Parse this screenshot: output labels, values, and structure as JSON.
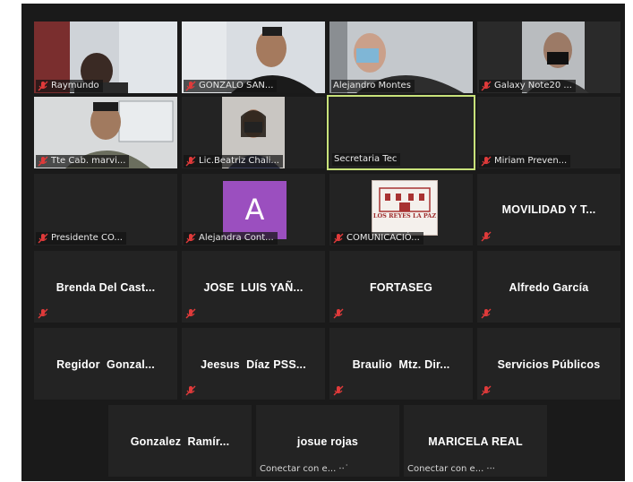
{
  "colors": {
    "background": "#1a1a1a",
    "tile": "#232323",
    "active_border": "#c8e27a",
    "mic_muted": "#e03a3a",
    "avatar_bg": "#9b4fbf"
  },
  "participants": [
    {
      "name": "Raymundo",
      "muted": true,
      "video": true
    },
    {
      "name": "GONZALO SAN...",
      "muted": true,
      "video": true
    },
    {
      "name": "Alejandro Montes",
      "muted": false,
      "video": true
    },
    {
      "name": "Galaxy Note20 ...",
      "muted": true,
      "video": true
    },
    {
      "name": "Tte Cab. marvi...",
      "muted": true,
      "video": true
    },
    {
      "name": "Lic.Beatriz Chali...",
      "muted": true,
      "video": true
    },
    {
      "name": "Secretaria Tec",
      "muted": false,
      "video": false,
      "active_speaker": true
    },
    {
      "name": "Miriam Preven...",
      "muted": true,
      "video": false
    },
    {
      "name": "Presidente CO...",
      "muted": true,
      "video": false
    },
    {
      "name": "Alejandra Cont...",
      "muted": true,
      "avatar_letter": "A"
    },
    {
      "name": "COMUNICACIÓ...",
      "muted": true,
      "logo_text": "LOS REYES LA PAZ"
    },
    {
      "name": "MOVILIDAD Y T...",
      "muted": true,
      "video": false
    },
    {
      "name": "Brenda Del Cast...",
      "muted": true
    },
    {
      "name": "JOSE  LUIS YAÑ...",
      "muted": true
    },
    {
      "name": "FORTASEG",
      "muted": true
    },
    {
      "name": "Alfredo García",
      "muted": true
    },
    {
      "name": "Regidor  Gonzal...",
      "muted": true
    },
    {
      "name": "Jeesus  Díaz PSS...",
      "muted": true
    },
    {
      "name": "Braulio  Mtz. Dir...",
      "muted": true
    },
    {
      "name": "Servicios Públicos",
      "muted": true
    },
    {
      "name": "Gonzalez  Ramír...",
      "muted": false
    },
    {
      "name": "josue rojas",
      "muted": false,
      "status": "Conectar con e... ⋅⋅˙"
    },
    {
      "name": "MARICELA REAL",
      "muted": false,
      "status": "Conectar con e... ⋅⋅⋅"
    }
  ]
}
